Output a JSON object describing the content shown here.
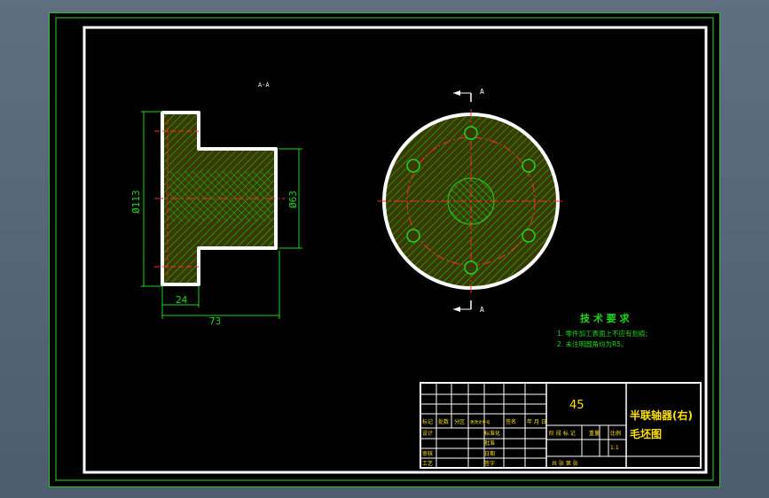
{
  "colors": {
    "outline": "#ffffff",
    "border_green": "#2bd62b",
    "hatch": "#19d919",
    "center_red": "#ff2a2a",
    "fill": "#4a4a00",
    "title_text": "#ffe100"
  },
  "section_label": "A-A",
  "cut_labels": {
    "top": "A",
    "bottom": "A"
  },
  "dimensions": {
    "outer_diameter": "Ø113",
    "hub_diameter": "Ø63",
    "flange_width": "24",
    "total_length": "73"
  },
  "tech_requirements": {
    "title": "技 术 要 求",
    "items": [
      "1. 零件加工表面上不应有划痕;",
      "2. 未注明圆角均为R5。"
    ]
  },
  "title_block": {
    "material": "45",
    "part_name": "半联轴器(右)",
    "drawing_type": "毛坯图",
    "scale_value": "1:1",
    "row_labels": [
      "标记",
      "处数",
      "分区",
      "更改文件号",
      "签名",
      "年 月 日"
    ],
    "left_labels": [
      "设计",
      "审核",
      "工艺"
    ],
    "mid_labels": [
      "标准化",
      "批准",
      "日期",
      "签字"
    ],
    "stage_labels": [
      "阶 段 标 记",
      "重量",
      "比例"
    ],
    "sheet_label": "共  张  第  张"
  }
}
